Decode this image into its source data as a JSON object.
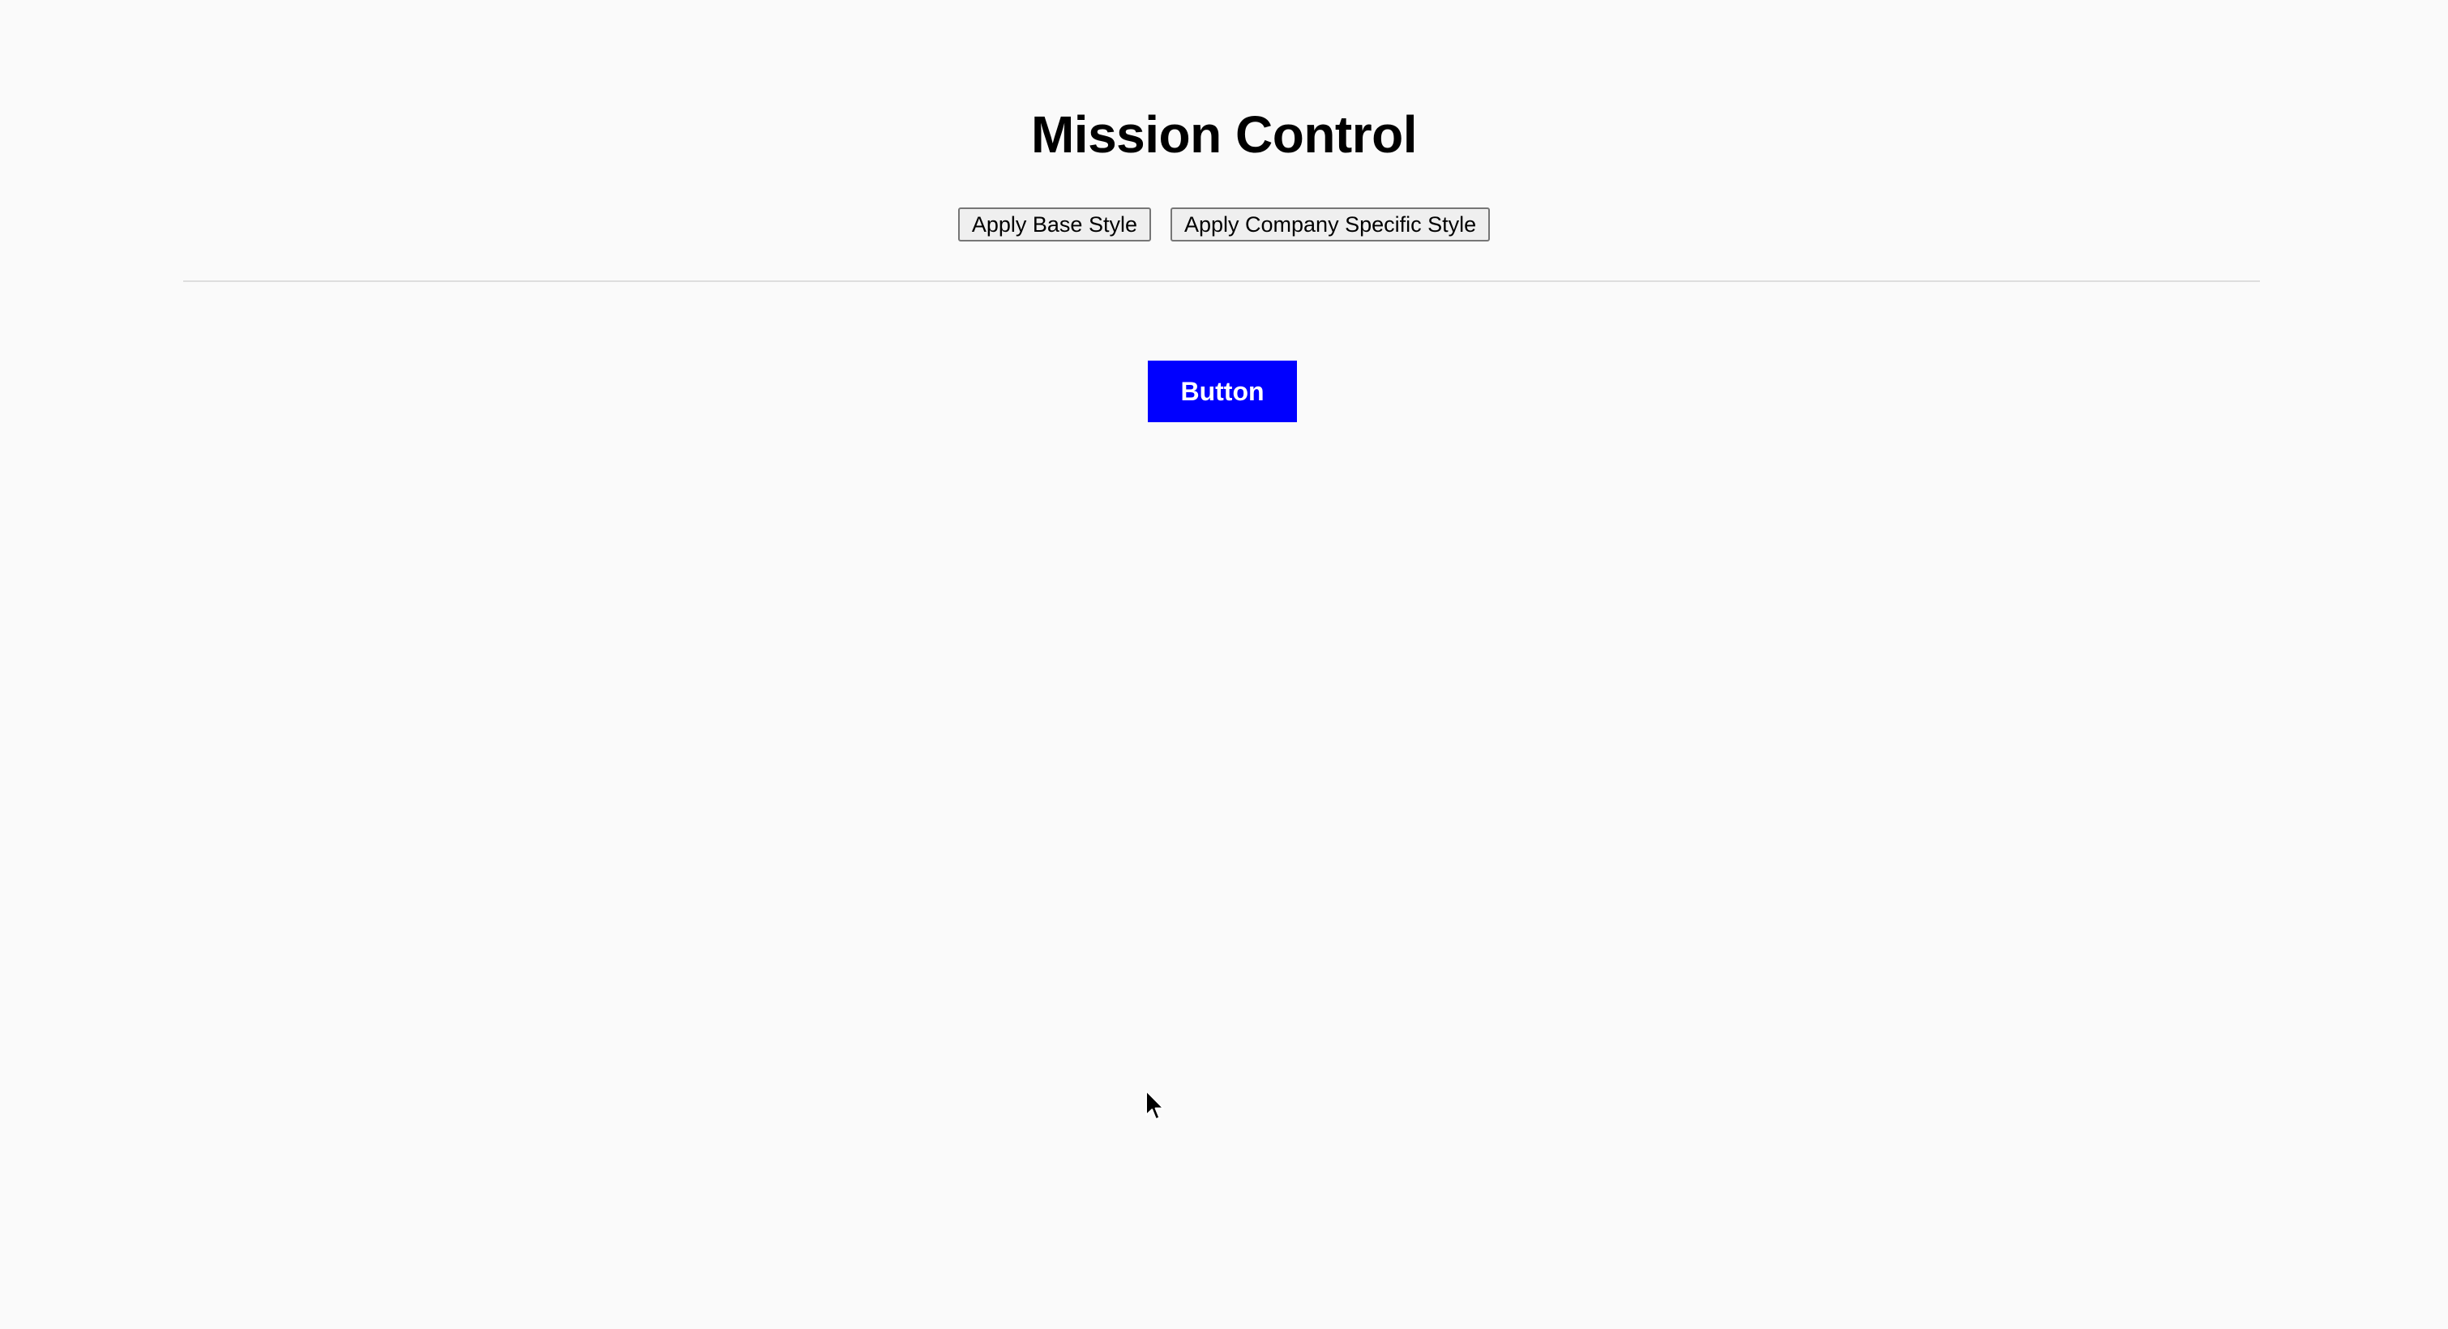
{
  "header": {
    "title": "Mission Control"
  },
  "controls": {
    "base_style_label": "Apply Base Style",
    "company_style_label": "Apply Company Specific Style"
  },
  "demo": {
    "button_label": "Button",
    "button_color": "#0000ff",
    "button_text_color": "#ffffff"
  },
  "pointer": {
    "icon": "mouse-pointer-icon"
  }
}
